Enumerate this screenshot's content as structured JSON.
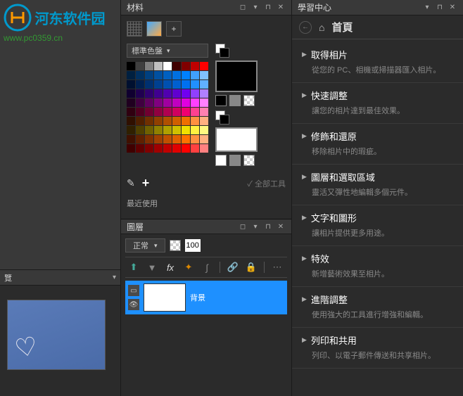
{
  "watermark": {
    "text": "河东软件园",
    "url": "www.pc0359.cn"
  },
  "panels": {
    "materials": {
      "title": "材料",
      "paletteLabel": "標準色盤",
      "recentLabel": "最近使用",
      "allToolsLabel": "全部工具"
    },
    "layers": {
      "title": "圖層",
      "blendMode": "正常",
      "opacity": "100",
      "layerName": "背景"
    },
    "learning": {
      "title": "學習中心",
      "homeLabel": "首頁",
      "items": [
        {
          "title": "取得相片",
          "desc": "從您的 PC、相機或掃描器匯入相片。"
        },
        {
          "title": "快速調整",
          "desc": "讓您的相片達到最佳效果。"
        },
        {
          "title": "修飾和還原",
          "desc": "移除相片中的瑕疵。"
        },
        {
          "title": "圖層和選取區域",
          "desc": "靈活又彈性地編輯多個元件。"
        },
        {
          "title": "文字和圖形",
          "desc": "讓相片提供更多用途。"
        },
        {
          "title": "特效",
          "desc": "新增藝術效果至相片。"
        },
        {
          "title": "進階調整",
          "desc": "使用強大的工具進行增強和編輯。"
        },
        {
          "title": "列印和共用",
          "desc": "列印、以電子郵件傳送和共享相片。"
        }
      ]
    }
  },
  "paletteColors": [
    "#000000",
    "#404040",
    "#808080",
    "#c0c0c0",
    "#ffffff",
    "#400000",
    "#800000",
    "#c00000",
    "#ff0000",
    "#002040",
    "#003060",
    "#004080",
    "#0050a0",
    "#0060c0",
    "#0070e0",
    "#0080ff",
    "#40a0ff",
    "#80c0ff",
    "#001030",
    "#002050",
    "#003070",
    "#004090",
    "#0050b0",
    "#0060d0",
    "#0070f0",
    "#2090ff",
    "#60b0ff",
    "#100030",
    "#200050",
    "#300070",
    "#400090",
    "#5000b0",
    "#6000d0",
    "#7000f0",
    "#9040ff",
    "#b080ff",
    "#200020",
    "#400040",
    "#600060",
    "#800080",
    "#a000a0",
    "#c000c0",
    "#e000e0",
    "#ff40ff",
    "#ff80ff",
    "#300010",
    "#500020",
    "#700030",
    "#900040",
    "#b00050",
    "#d00060",
    "#f00070",
    "#ff4090",
    "#ff80b0",
    "#301000",
    "#502000",
    "#703000",
    "#904000",
    "#b05000",
    "#d06000",
    "#f07000",
    "#ff9040",
    "#ffb080",
    "#302000",
    "#504000",
    "#706000",
    "#908000",
    "#b0a000",
    "#d0c000",
    "#f0e000",
    "#fff040",
    "#fff880",
    "#401000",
    "#602000",
    "#803000",
    "#a04000",
    "#c05000",
    "#e06000",
    "#ff7000",
    "#ff9040",
    "#ffb080",
    "#400000",
    "#600000",
    "#800000",
    "#a00000",
    "#c00000",
    "#e00000",
    "#ff0000",
    "#ff4040",
    "#ff8080"
  ]
}
